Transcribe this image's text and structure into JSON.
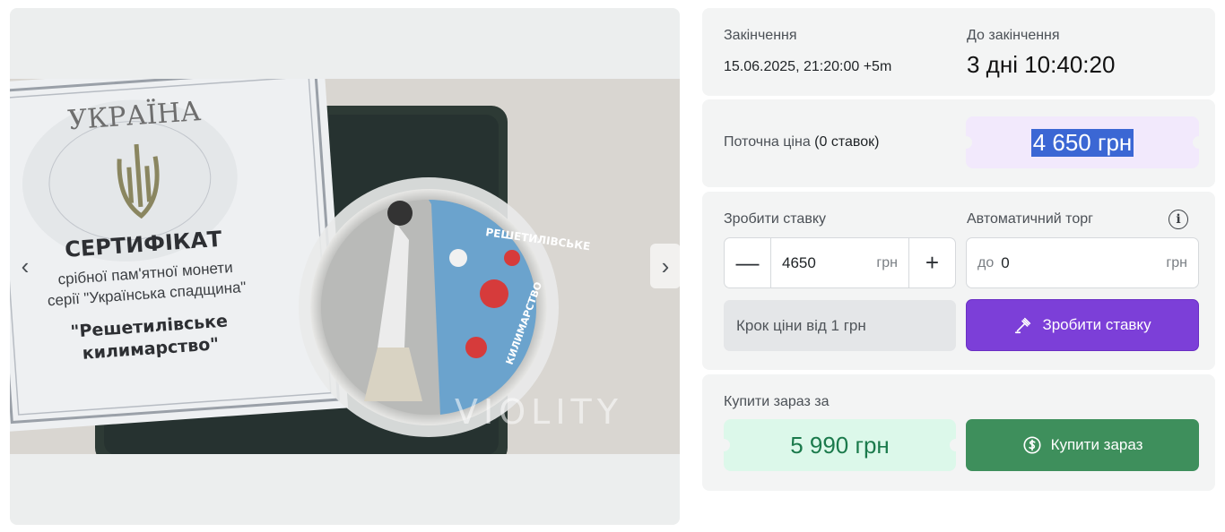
{
  "gallery": {
    "image_alt": "Coin photo with certificate",
    "certificate": {
      "country": "УКРАЇНА",
      "title": "СЕРТИФІКАТ",
      "line1": "срібної пам'ятної монети",
      "line2": "серії \"Українська спадщина\"",
      "name1": "\"Решетилівське",
      "name2": "килимарство\""
    },
    "coin_text1": "РЕШЕТИЛІВСЬКЕ",
    "coin_text2": "КИЛИМАРСТВО",
    "watermark": "VIOLITY",
    "prev_icon": "chevron-left-icon",
    "next_icon": "chevron-right-icon"
  },
  "ending": {
    "label": "Закінчення",
    "date": "15.06.2025, 21:20:00 +5m",
    "remaining_label": "До закінчення",
    "remaining": "3 дні 10:40:20"
  },
  "current": {
    "label": "Поточна ціна",
    "bids": "(0 ставок)",
    "price": "4 650 грн"
  },
  "bid": {
    "label": "Зробити ставку",
    "value": "4650",
    "unit": "грн",
    "auto_label": "Автоматичний торг",
    "auto_prefix": "до",
    "auto_value": "0",
    "auto_unit": "грн",
    "step_text": "Крок ціни від 1 грн",
    "button": "Зробити ставку",
    "minus": "—",
    "plus": "+"
  },
  "buy_now": {
    "label": "Купити зараз за",
    "price": "5 990 грн",
    "button": "Купити зараз"
  },
  "colors": {
    "purple": "#7c3fd8",
    "green": "#3e8f5c",
    "selection": "#3b67d4"
  }
}
